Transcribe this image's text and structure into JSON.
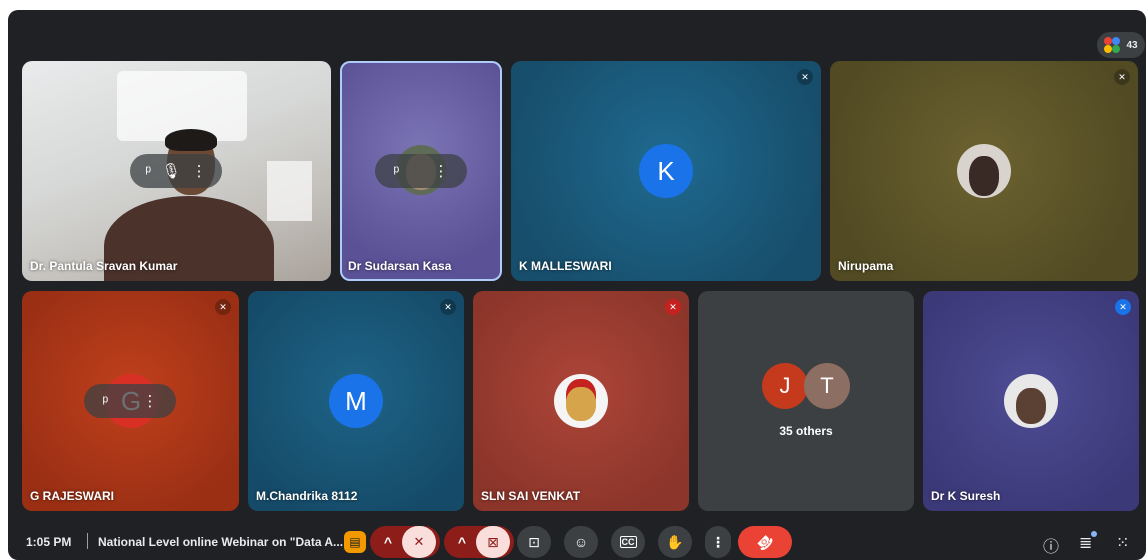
{
  "meeting": {
    "participant_count": "43",
    "time": "1:05 PM",
    "title": "National Level online Webinar on \"Data A...",
    "others_label": "35 others"
  },
  "tiles": [
    {
      "name": "Dr. Pantula Sravan Kumar"
    },
    {
      "name": "Dr Sudarsan Kasa"
    },
    {
      "name": "K MALLESWARI",
      "initial": "K"
    },
    {
      "name": "Nirupama"
    },
    {
      "name": "G RAJESWARI"
    },
    {
      "name": "M.Chandrika 8112",
      "initial": "M"
    },
    {
      "name": "SLN SAI VENKAT"
    },
    {
      "name": "",
      "avatars": [
        "J",
        "T"
      ]
    },
    {
      "name": "Dr K Suresh"
    }
  ],
  "icons": {
    "pin": "📌",
    "mic_off": "🎤",
    "more": "⋮",
    "caret_up": "^",
    "cam_off": "⊠",
    "present": "⊡",
    "emoji": "☺",
    "captions": "CC",
    "hand": "✋",
    "end": "☎",
    "info": "ⓘ",
    "chat": "≣",
    "activities": "⁙"
  },
  "colors": {
    "accent_blue": "#1a73e8",
    "end_call_red": "#ea4335",
    "mic_muted_bg": "#f9dedc"
  }
}
